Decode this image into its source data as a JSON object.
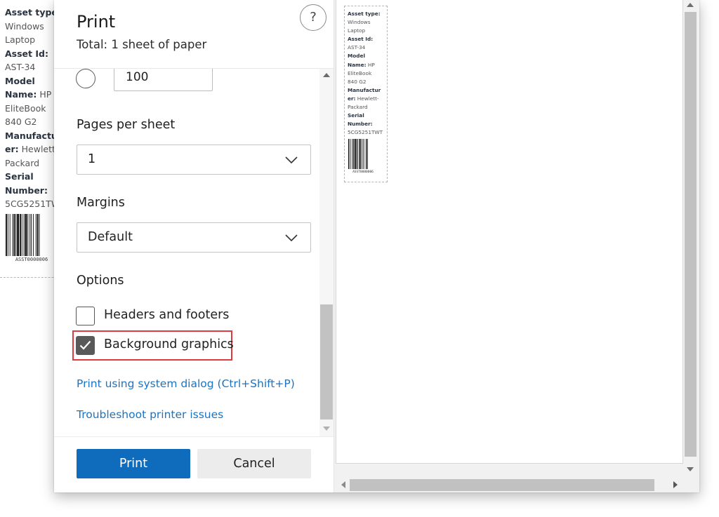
{
  "background_label": {
    "lines": [
      {
        "key": "Asset type",
        "val": ""
      },
      {
        "key": "",
        "val": "Windows"
      },
      {
        "key": "",
        "val": "Laptop"
      },
      {
        "key": "Asset Id:",
        "val": ""
      },
      {
        "key": "",
        "val": "AST-34"
      },
      {
        "key": "Model",
        "val": ""
      },
      {
        "key": "Name:",
        "val": " HP"
      },
      {
        "key": "",
        "val": "EliteBook"
      },
      {
        "key": "",
        "val": "840 G2"
      },
      {
        "key": "Manufactu",
        "val": ""
      },
      {
        "key": "er:",
        "val": " Hewlett-"
      },
      {
        "key": "",
        "val": "Packard"
      },
      {
        "key": "Serial",
        "val": ""
      },
      {
        "key": "Number:",
        "val": ""
      },
      {
        "key": "",
        "val": "5CG5251TW"
      }
    ],
    "barcode_text": "ASST0000006"
  },
  "dialog": {
    "title": "Print",
    "subtitle": "Total: 1 sheet of paper",
    "help_label": "?",
    "scale_value": "100",
    "pages_per_sheet": {
      "label": "Pages per sheet",
      "value": "1"
    },
    "margins": {
      "label": "Margins",
      "value": "Default"
    },
    "options": {
      "label": "Options",
      "headers_footers": {
        "label": "Headers and footers",
        "checked": false
      },
      "background_graphics": {
        "label": "Background graphics",
        "checked": true
      }
    },
    "links": {
      "system_dialog": "Print using system dialog (Ctrl+Shift+P)",
      "troubleshoot": "Troubleshoot printer issues"
    },
    "buttons": {
      "print": "Print",
      "cancel": "Cancel"
    }
  },
  "preview": {
    "label_lines": [
      {
        "key": "Asset type:",
        "val": ""
      },
      {
        "key": "",
        "val": "Windows"
      },
      {
        "key": "",
        "val": "Laptop"
      },
      {
        "key": "Asset Id:",
        "val": ""
      },
      {
        "key": "",
        "val": "AST-34"
      },
      {
        "key": "Model",
        "val": ""
      },
      {
        "key": "Name:",
        "val": " HP"
      },
      {
        "key": "",
        "val": "EliteBook"
      },
      {
        "key": "",
        "val": "840 G2"
      },
      {
        "key": "Manufactur",
        "val": ""
      },
      {
        "key": "er:",
        "val": " Hewlett-"
      },
      {
        "key": "",
        "val": "Packard"
      },
      {
        "key": "Serial",
        "val": ""
      },
      {
        "key": "Number:",
        "val": ""
      },
      {
        "key": "",
        "val": "5CG5251TWT"
      }
    ],
    "barcode_text": "ASST0000006"
  },
  "colors": {
    "accent": "#0f6cbd",
    "link": "#1a73c4",
    "highlight": "#e0393e"
  }
}
